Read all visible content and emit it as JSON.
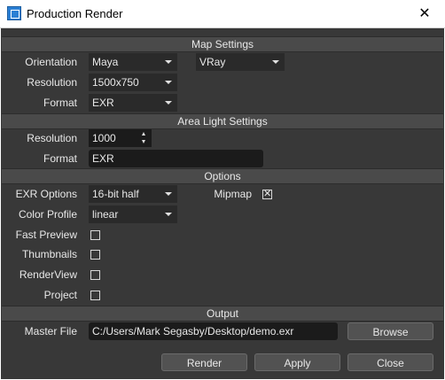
{
  "window": {
    "title": "Production Render",
    "close_glyph": "✕"
  },
  "sections": {
    "map": "Map Settings",
    "area_light": "Area Light Settings",
    "options": "Options",
    "output": "Output"
  },
  "map": {
    "orientation_label": "Orientation",
    "orientation_value": "Maya",
    "renderer_value": "VRay",
    "resolution_label": "Resolution",
    "resolution_value": "1500x750",
    "format_label": "Format",
    "format_value": "EXR"
  },
  "area_light": {
    "resolution_label": "Resolution",
    "resolution_value": "1000",
    "format_label": "Format",
    "format_value": "EXR"
  },
  "options": {
    "exr_options_label": "EXR Options",
    "exr_options_value": "16-bit half",
    "mipmap_label": "Mipmap",
    "mipmap_checked": true,
    "mipmap_mark": "✕",
    "color_profile_label": "Color Profile",
    "color_profile_value": "linear",
    "fast_preview_label": "Fast Preview",
    "thumbnails_label": "Thumbnails",
    "renderview_label": "RenderView",
    "project_label": "Project"
  },
  "output": {
    "master_file_label": "Master File",
    "master_file_value": "C:/Users/Mark Segasby/Desktop/demo.exr",
    "browse_label": "Browse"
  },
  "footer": {
    "render_label": "Render",
    "apply_label": "Apply",
    "close_label": "Close"
  }
}
